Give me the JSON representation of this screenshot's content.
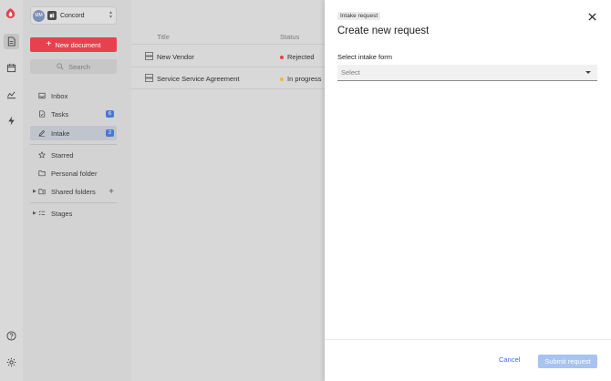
{
  "rail": {
    "items": [
      "logo-icon",
      "documents-icon",
      "calendar-icon",
      "analytics-icon",
      "automation-icon",
      "help-icon",
      "settings-icon"
    ]
  },
  "workspace": {
    "avatar": "MM",
    "name": "Concord"
  },
  "sidebar": {
    "new_document": "New document",
    "search_placeholder": "Search",
    "items": [
      {
        "label": "Inbox"
      },
      {
        "label": "Tasks",
        "badge": "6"
      },
      {
        "label": "Intake",
        "badge": "2"
      },
      {
        "label": "Starred"
      },
      {
        "label": "Personal folder"
      },
      {
        "label": "Shared folders"
      },
      {
        "label": "Stages"
      }
    ]
  },
  "list": {
    "columns": [
      "Title",
      "Status"
    ],
    "rows": [
      {
        "title": "New Vendor",
        "status": "Rejected",
        "status_color": "#e8414e"
      },
      {
        "title": "Service Service Agreement",
        "status": "In progress",
        "status_color": "#f0b93a"
      }
    ]
  },
  "drawer": {
    "tag": "Intake request",
    "title": "Create new request",
    "field_label": "Select intake form",
    "select_placeholder": "Select",
    "cancel": "Cancel",
    "submit": "Submit request"
  },
  "colors": {
    "accent": "#e8414e",
    "badge": "#4a78d6",
    "link": "#3b6fd6",
    "submit_disabled": "#a8c3f0"
  }
}
